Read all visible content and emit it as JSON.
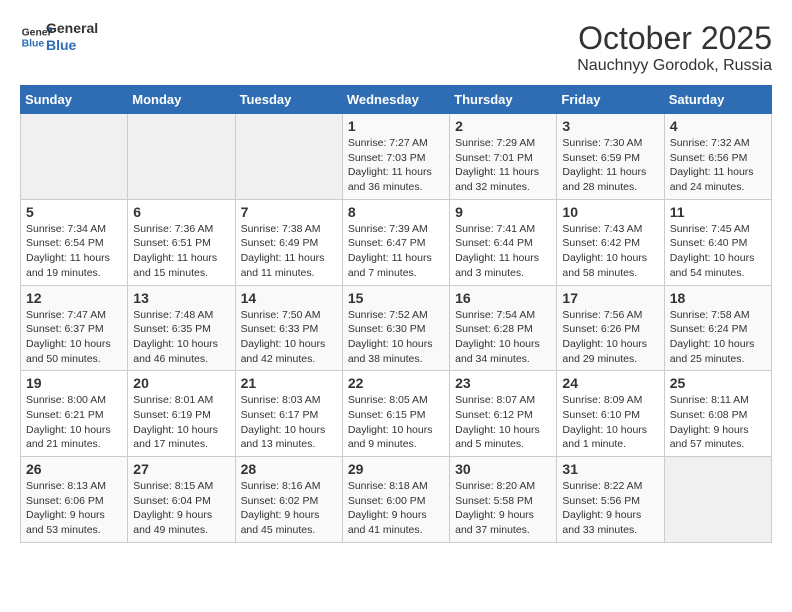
{
  "logo": {
    "line1": "General",
    "line2": "Blue"
  },
  "title": "October 2025",
  "subtitle": "Nauchnyy Gorodok, Russia",
  "days_of_week": [
    "Sunday",
    "Monday",
    "Tuesday",
    "Wednesday",
    "Thursday",
    "Friday",
    "Saturday"
  ],
  "weeks": [
    [
      {
        "day": "",
        "info": ""
      },
      {
        "day": "",
        "info": ""
      },
      {
        "day": "",
        "info": ""
      },
      {
        "day": "1",
        "info": "Sunrise: 7:27 AM\nSunset: 7:03 PM\nDaylight: 11 hours\nand 36 minutes."
      },
      {
        "day": "2",
        "info": "Sunrise: 7:29 AM\nSunset: 7:01 PM\nDaylight: 11 hours\nand 32 minutes."
      },
      {
        "day": "3",
        "info": "Sunrise: 7:30 AM\nSunset: 6:59 PM\nDaylight: 11 hours\nand 28 minutes."
      },
      {
        "day": "4",
        "info": "Sunrise: 7:32 AM\nSunset: 6:56 PM\nDaylight: 11 hours\nand 24 minutes."
      }
    ],
    [
      {
        "day": "5",
        "info": "Sunrise: 7:34 AM\nSunset: 6:54 PM\nDaylight: 11 hours\nand 19 minutes."
      },
      {
        "day": "6",
        "info": "Sunrise: 7:36 AM\nSunset: 6:51 PM\nDaylight: 11 hours\nand 15 minutes."
      },
      {
        "day": "7",
        "info": "Sunrise: 7:38 AM\nSunset: 6:49 PM\nDaylight: 11 hours\nand 11 minutes."
      },
      {
        "day": "8",
        "info": "Sunrise: 7:39 AM\nSunset: 6:47 PM\nDaylight: 11 hours\nand 7 minutes."
      },
      {
        "day": "9",
        "info": "Sunrise: 7:41 AM\nSunset: 6:44 PM\nDaylight: 11 hours\nand 3 minutes."
      },
      {
        "day": "10",
        "info": "Sunrise: 7:43 AM\nSunset: 6:42 PM\nDaylight: 10 hours\nand 58 minutes."
      },
      {
        "day": "11",
        "info": "Sunrise: 7:45 AM\nSunset: 6:40 PM\nDaylight: 10 hours\nand 54 minutes."
      }
    ],
    [
      {
        "day": "12",
        "info": "Sunrise: 7:47 AM\nSunset: 6:37 PM\nDaylight: 10 hours\nand 50 minutes."
      },
      {
        "day": "13",
        "info": "Sunrise: 7:48 AM\nSunset: 6:35 PM\nDaylight: 10 hours\nand 46 minutes."
      },
      {
        "day": "14",
        "info": "Sunrise: 7:50 AM\nSunset: 6:33 PM\nDaylight: 10 hours\nand 42 minutes."
      },
      {
        "day": "15",
        "info": "Sunrise: 7:52 AM\nSunset: 6:30 PM\nDaylight: 10 hours\nand 38 minutes."
      },
      {
        "day": "16",
        "info": "Sunrise: 7:54 AM\nSunset: 6:28 PM\nDaylight: 10 hours\nand 34 minutes."
      },
      {
        "day": "17",
        "info": "Sunrise: 7:56 AM\nSunset: 6:26 PM\nDaylight: 10 hours\nand 29 minutes."
      },
      {
        "day": "18",
        "info": "Sunrise: 7:58 AM\nSunset: 6:24 PM\nDaylight: 10 hours\nand 25 minutes."
      }
    ],
    [
      {
        "day": "19",
        "info": "Sunrise: 8:00 AM\nSunset: 6:21 PM\nDaylight: 10 hours\nand 21 minutes."
      },
      {
        "day": "20",
        "info": "Sunrise: 8:01 AM\nSunset: 6:19 PM\nDaylight: 10 hours\nand 17 minutes."
      },
      {
        "day": "21",
        "info": "Sunrise: 8:03 AM\nSunset: 6:17 PM\nDaylight: 10 hours\nand 13 minutes."
      },
      {
        "day": "22",
        "info": "Sunrise: 8:05 AM\nSunset: 6:15 PM\nDaylight: 10 hours\nand 9 minutes."
      },
      {
        "day": "23",
        "info": "Sunrise: 8:07 AM\nSunset: 6:12 PM\nDaylight: 10 hours\nand 5 minutes."
      },
      {
        "day": "24",
        "info": "Sunrise: 8:09 AM\nSunset: 6:10 PM\nDaylight: 10 hours\nand 1 minute."
      },
      {
        "day": "25",
        "info": "Sunrise: 8:11 AM\nSunset: 6:08 PM\nDaylight: 9 hours\nand 57 minutes."
      }
    ],
    [
      {
        "day": "26",
        "info": "Sunrise: 8:13 AM\nSunset: 6:06 PM\nDaylight: 9 hours\nand 53 minutes."
      },
      {
        "day": "27",
        "info": "Sunrise: 8:15 AM\nSunset: 6:04 PM\nDaylight: 9 hours\nand 49 minutes."
      },
      {
        "day": "28",
        "info": "Sunrise: 8:16 AM\nSunset: 6:02 PM\nDaylight: 9 hours\nand 45 minutes."
      },
      {
        "day": "29",
        "info": "Sunrise: 8:18 AM\nSunset: 6:00 PM\nDaylight: 9 hours\nand 41 minutes."
      },
      {
        "day": "30",
        "info": "Sunrise: 8:20 AM\nSunset: 5:58 PM\nDaylight: 9 hours\nand 37 minutes."
      },
      {
        "day": "31",
        "info": "Sunrise: 8:22 AM\nSunset: 5:56 PM\nDaylight: 9 hours\nand 33 minutes."
      },
      {
        "day": "",
        "info": ""
      }
    ]
  ]
}
